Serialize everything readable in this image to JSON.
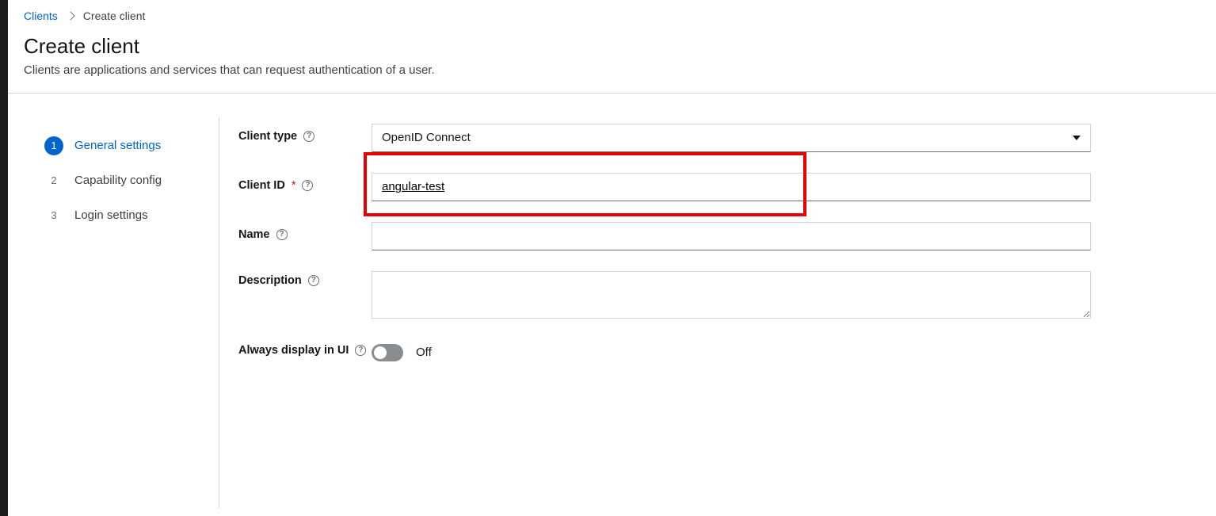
{
  "breadcrumbs": {
    "root": "Clients",
    "current": "Create client"
  },
  "header": {
    "title": "Create client",
    "subtitle": "Clients are applications and services that can request authentication of a user."
  },
  "wizard": {
    "steps": [
      {
        "num": "1",
        "label": "General settings"
      },
      {
        "num": "2",
        "label": "Capability config"
      },
      {
        "num": "3",
        "label": "Login settings"
      }
    ]
  },
  "form": {
    "client_type": {
      "label": "Client type",
      "value": "OpenID Connect"
    },
    "client_id": {
      "label": "Client ID",
      "value": "angular-test"
    },
    "name": {
      "label": "Name",
      "value": ""
    },
    "description": {
      "label": "Description",
      "value": ""
    },
    "always_display": {
      "label": "Always display in UI",
      "value_text": "Off"
    }
  }
}
